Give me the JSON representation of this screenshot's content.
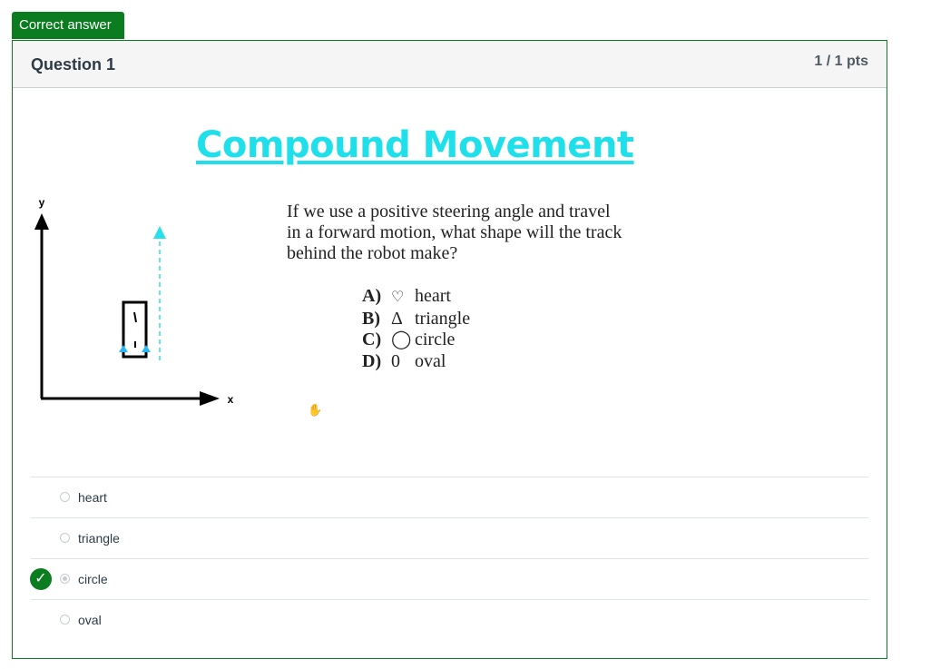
{
  "badge": {
    "label": "Correct answer"
  },
  "question": {
    "title": "Question 1",
    "points": "1 / 1 pts"
  },
  "slide": {
    "title": "Compound Movement",
    "prompt": "If we use a positive steering angle and travel in a forward motion, what shape will the track behind the robot make?",
    "axis_y": "y",
    "axis_x": "x",
    "options": [
      {
        "key": "A)",
        "symbol": "♡",
        "text": "heart"
      },
      {
        "key": "B)",
        "symbol": "Δ",
        "text": "triangle"
      },
      {
        "key": "C)",
        "symbol": "◯",
        "text": "circle"
      },
      {
        "key": "D)",
        "symbol": "0",
        "text": "oval"
      }
    ]
  },
  "answers": [
    {
      "label": "heart",
      "selected": false,
      "correct": false
    },
    {
      "label": "triangle",
      "selected": false,
      "correct": false
    },
    {
      "label": "circle",
      "selected": true,
      "correct": true
    },
    {
      "label": "oval",
      "selected": false,
      "correct": false
    }
  ],
  "colors": {
    "correct_green": "#0b7d20",
    "title_cyan": "#1fe0ea",
    "arrow_blue": "#29b6f6"
  },
  "icons": {
    "check": "check-icon",
    "hand": "hand-cursor-icon"
  }
}
